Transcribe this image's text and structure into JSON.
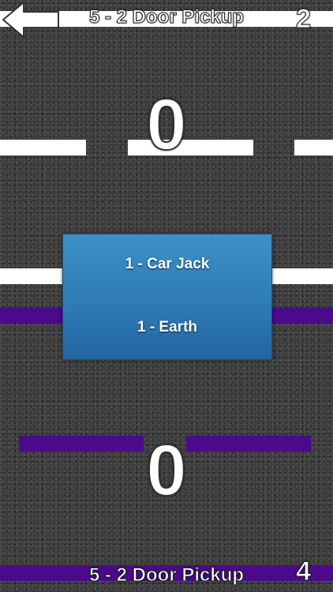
{
  "header": {
    "title": "5 - 2 Door Pickup",
    "count": "2",
    "back_icon": "left-arrow-icon"
  },
  "scores": {
    "top": "0",
    "bottom": "0"
  },
  "card": {
    "line1": "1 - Car Jack",
    "line2": "1 - Earth"
  },
  "footer": {
    "title": "5 - 2 Door Pickup",
    "count": "4"
  },
  "colors": {
    "asphalt": "#3e3e3e",
    "lane_white": "#ffffff",
    "lane_purple": "#4b0a8a",
    "card_blue": "#2f7bb6"
  }
}
